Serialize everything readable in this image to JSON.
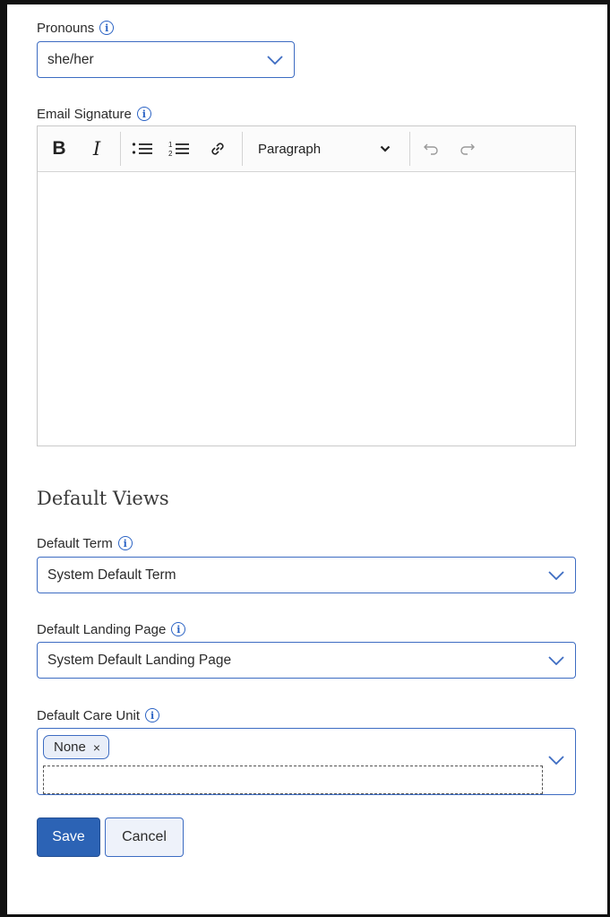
{
  "pronouns": {
    "label": "Pronouns",
    "value": "she/her"
  },
  "email_signature": {
    "label": "Email Signature",
    "toolbar": {
      "bold": "B",
      "italic": "I",
      "bulleted_list": "bulleted-list-icon",
      "numbered_list": "numbered-list-icon",
      "link": "link-icon",
      "block_format": "Paragraph",
      "undo": "undo-icon",
      "redo": "redo-icon"
    },
    "content": ""
  },
  "default_views": {
    "heading": "Default Views",
    "term": {
      "label": "Default Term",
      "value": "System Default Term"
    },
    "landing_page": {
      "label": "Default Landing Page",
      "value": "System Default Landing Page"
    },
    "care_unit": {
      "label": "Default Care Unit",
      "chips": [
        "None"
      ],
      "chip_remove": "×"
    }
  },
  "actions": {
    "save": "Save",
    "cancel": "Cancel"
  },
  "colors": {
    "accent": "#2c63b5",
    "border": "#3d6cc2",
    "info": "#2b63c4"
  }
}
